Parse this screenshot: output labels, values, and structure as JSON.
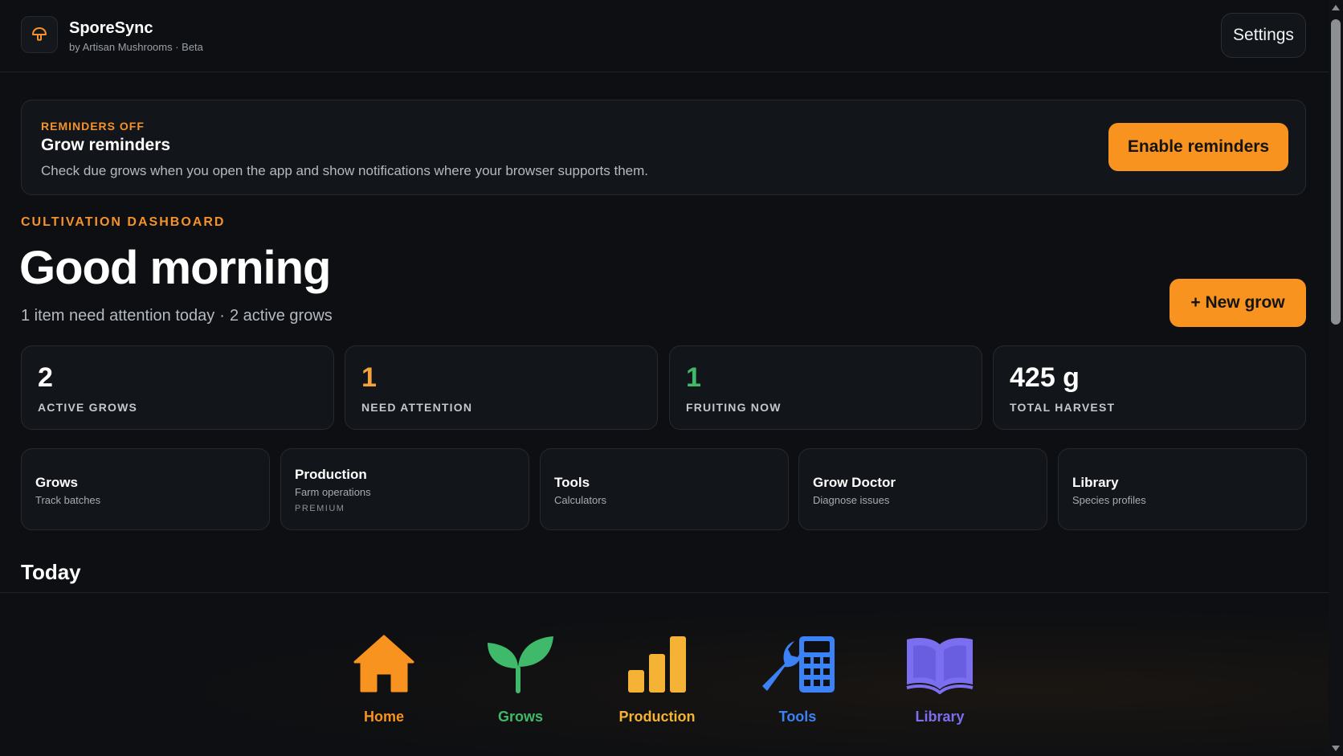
{
  "header": {
    "app_name": "SporeSync",
    "subtitle": "by Artisan Mushrooms · Beta",
    "logo_icon": "mushroom-icon",
    "settings_label": "Settings"
  },
  "banner": {
    "eyebrow": "REMINDERS OFF",
    "title": "Grow reminders",
    "description": "Check due grows when you open the app and show notifications where your browser supports them.",
    "button_label": "Enable reminders"
  },
  "dashboard": {
    "eyebrow": "CULTIVATION DASHBOARD",
    "greeting": "Good morning",
    "summary_attention": "1 item need attention today",
    "summary_separator": "·",
    "summary_active": "2 active grows",
    "new_grow_label": "+ New grow"
  },
  "stats": [
    {
      "value": "2",
      "label": "ACTIVE GROWS",
      "color": "#ffffff"
    },
    {
      "value": "1",
      "label": "NEED ATTENTION",
      "color": "#f5a33a"
    },
    {
      "value": "1",
      "label": "FRUITING NOW",
      "color": "#3fba6a"
    },
    {
      "value": "425 g",
      "label": "TOTAL HARVEST",
      "color": "#ffffff"
    }
  ],
  "cards": [
    {
      "title": "Grows",
      "subtitle": "Track batches"
    },
    {
      "title": "Production",
      "subtitle": "Farm operations",
      "badge": "PREMIUM"
    },
    {
      "title": "Tools",
      "subtitle": "Calculators"
    },
    {
      "title": "Grow Doctor",
      "subtitle": "Diagnose issues"
    },
    {
      "title": "Library",
      "subtitle": "Species profiles"
    }
  ],
  "section_today": "Today",
  "bottom_nav": [
    {
      "label": "Home",
      "icon": "house-icon",
      "color": "#f7931e"
    },
    {
      "label": "Grows",
      "icon": "sprout-icon",
      "color": "#3fba6a"
    },
    {
      "label": "Production",
      "icon": "bar-chart-icon",
      "color": "#f5b335"
    },
    {
      "label": "Tools",
      "icon": "tools-calculator-icon",
      "color": "#3b82f6"
    },
    {
      "label": "Library",
      "icon": "open-book-icon",
      "color": "#7b6ff0"
    }
  ]
}
